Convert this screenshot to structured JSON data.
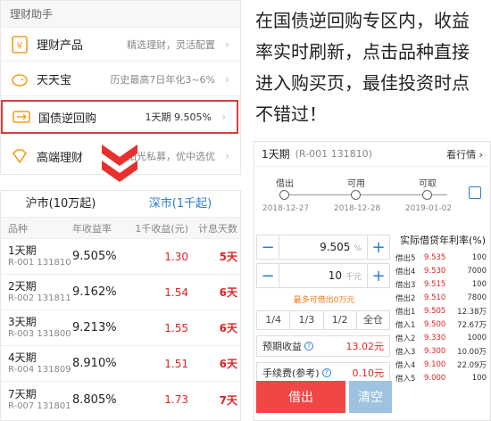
{
  "menu": {
    "title": "理财助手",
    "items": [
      {
        "name": "理财产品",
        "desc": "精选理财，灵活配置",
        "icon": "yen-icon"
      },
      {
        "name": "天天宝",
        "desc": "历史最高7日年化3~6%",
        "icon": "piggy-bank-icon"
      },
      {
        "name": "国债逆回购",
        "desc": "1天期 9.505%",
        "icon": "bond-icon"
      },
      {
        "name": "高端理财",
        "desc": "阳光私募，优中选优",
        "icon": "diamond-icon"
      }
    ],
    "accent": "#e03b3b"
  },
  "blurb": "在国债逆回购专区内，收益率实时刷新，点击品种直接进入购买页，最佳投资时点不错过！",
  "list": {
    "tabs": [
      "沪市(10万起)",
      "深市(1千起)"
    ],
    "headers": [
      "品种",
      "年收益率",
      "1千收益(元)",
      "计息天数"
    ],
    "rows": [
      {
        "period": "1天期",
        "code": "R-001 131810",
        "rate": "9.505%",
        "income": "1.30",
        "days": "5天"
      },
      {
        "period": "2天期",
        "code": "R-002 131811",
        "rate": "9.162%",
        "income": "1.54",
        "days": "6天"
      },
      {
        "period": "3天期",
        "code": "R-003 131800",
        "rate": "9.213%",
        "income": "1.55",
        "days": "6天"
      },
      {
        "period": "4天期",
        "code": "R-004 131809",
        "rate": "8.910%",
        "income": "1.51",
        "days": "6天"
      },
      {
        "period": "7天期",
        "code": "R-007 131801",
        "rate": "8.805%",
        "income": "1.73",
        "days": "7天"
      }
    ]
  },
  "trade": {
    "title": "1天期",
    "code": "(R-001 131810)",
    "view_quote": "看行情",
    "timeline": [
      {
        "label": "借出",
        "date": "2018-12-27"
      },
      {
        "label": "可用",
        "date": "2018-12-28"
      },
      {
        "label": "可取",
        "date": "2019-01-02"
      }
    ],
    "rate_value": "9.505",
    "rate_unit": "%",
    "amount_value": "10",
    "amount_unit": "千元",
    "max_hint": "最多可借出0万元",
    "fractions": [
      "1/4",
      "1/3",
      "1/2",
      "全仓"
    ],
    "expected_label": "预期收益",
    "expected_value": "13.02元",
    "fee_label": "手续费(参考)",
    "fee_value": "0.10元",
    "lend_button": "借出",
    "clear_button": "清空",
    "book_title": "实际借贷年利率(%)",
    "book": [
      {
        "label": "借出5",
        "price": "9.535",
        "qty": "100"
      },
      {
        "label": "借出4",
        "price": "9.530",
        "qty": "7000"
      },
      {
        "label": "借出3",
        "price": "9.515",
        "qty": "100"
      },
      {
        "label": "借出2",
        "price": "9.510",
        "qty": "7800"
      },
      {
        "label": "借出1",
        "price": "9.505",
        "qty": "12.38万"
      },
      {
        "label": "借入1",
        "price": "9.500",
        "qty": "72.67万"
      },
      {
        "label": "借入2",
        "price": "9.330",
        "qty": "1000"
      },
      {
        "label": "借入3",
        "price": "9.300",
        "qty": "10.00万"
      },
      {
        "label": "借入4",
        "price": "9.100",
        "qty": "22.09万"
      },
      {
        "label": "借入5",
        "price": "9.000",
        "qty": "100"
      }
    ]
  }
}
